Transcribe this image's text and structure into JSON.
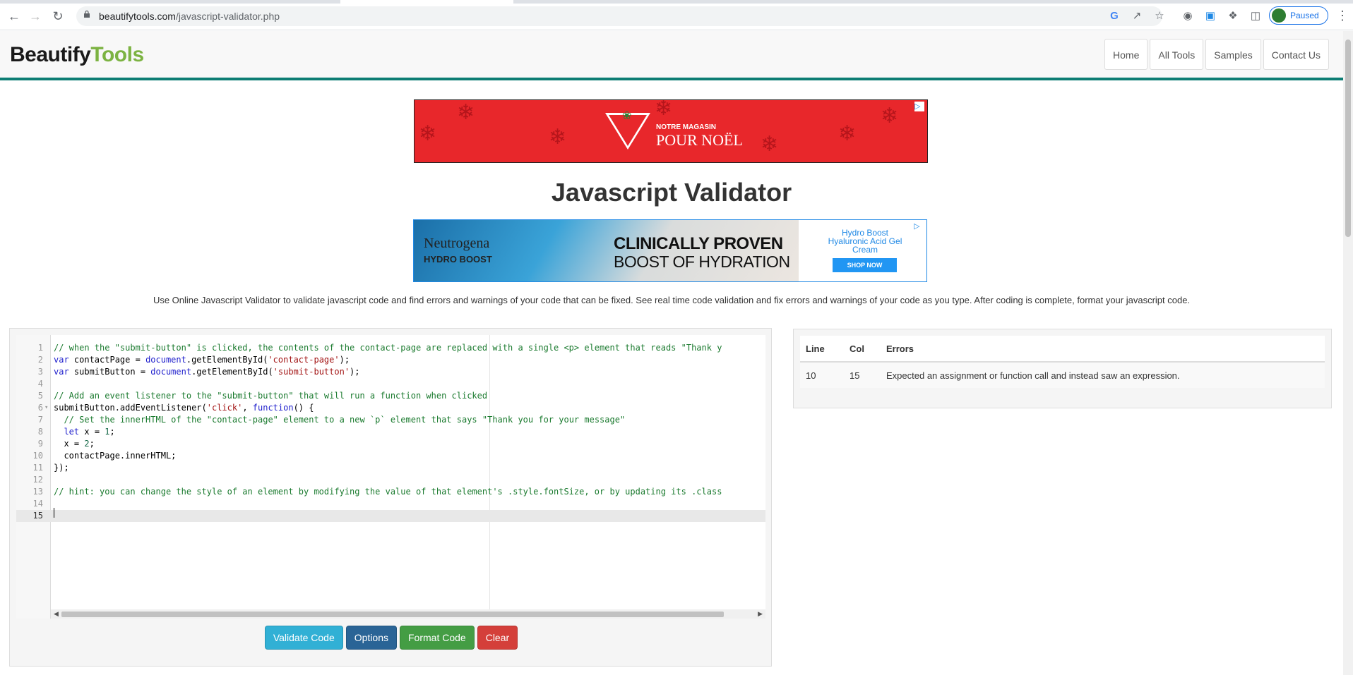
{
  "browser": {
    "url_host": "beautifytools.com",
    "url_path": "/javascript-validator.php",
    "profile_label": "Paused"
  },
  "site": {
    "logo_part1": "Beautify",
    "logo_part2": "Tools",
    "nav": [
      "Home",
      "All Tools",
      "Samples",
      "Contact Us"
    ]
  },
  "ads": {
    "ad1_small": "NOTRE MAGASIN",
    "ad1_big": "POUR NOËL",
    "ad2_brand": "Neutrogena",
    "ad2_sub": "HYDRO BOOST",
    "ad2_head1": "CLINICALLY PROVEN",
    "ad2_head2": "BOOST OF HYDRATION",
    "ad2_side": "Hydro Boost Hyaluronic Acid Gel Cream",
    "ad2_cta": "SHOP NOW"
  },
  "page": {
    "title": "Javascript Validator",
    "description": "Use Online Javascript Validator to validate javascript code and find errors and warnings of your code that can be fixed. See real time code validation and fix errors and warnings of your code as you type. After coding is complete, format your javascript code."
  },
  "editor": {
    "lines": [
      "// when the \"submit-button\" is clicked, the contents of the contact-page are replaced with a single <p> element that reads \"Thank y",
      "var contactPage = document.getElementById('contact-page');",
      "var submitButton = document.getElementById('submit-button');",
      "",
      "// Add an event listener to the \"submit-button\" that will run a function when clicked",
      "submitButton.addEventListener('click', function() {",
      "  // Set the innerHTML of the \"contact-page\" element to a new `p` element that says \"Thank you for your message\"",
      "  let x = 1;",
      "  x = 2;",
      "  contactPage.innerHTML;",
      "});",
      "",
      "// hint: you can change the style of an element by modifying the value of that element's .style.fontSize, or by updating its .class",
      "",
      ""
    ]
  },
  "buttons": {
    "validate": "Validate Code",
    "options": "Options",
    "format": "Format Code",
    "clear": "Clear"
  },
  "errors": {
    "headers": [
      "Line",
      "Col",
      "Errors"
    ],
    "rows": [
      {
        "line": "10",
        "col": "15",
        "message": "Expected an assignment or function call and instead saw an expression."
      }
    ]
  }
}
